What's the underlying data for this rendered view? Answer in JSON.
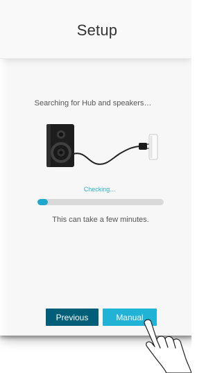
{
  "header": {
    "title": "Setup"
  },
  "status": {
    "searching_text": "Searching for Hub and speakers…",
    "checking_text": "Checking…",
    "progress_fraction": 0.08,
    "hint_text": "This can take a few minutes."
  },
  "buttons": {
    "previous_label": "Previous",
    "manual_label": "Manual"
  },
  "colors": {
    "accent": "#21b3d6",
    "accent_dark": "#005f78",
    "progress_fill": "#1fa7cc",
    "progress_track": "#d9d9d9",
    "checking_text": "#2fb0d1"
  },
  "icons": {
    "illustration": "speaker-plugged-into-wall-outlet",
    "pointer": "tapping-hand-icon"
  }
}
